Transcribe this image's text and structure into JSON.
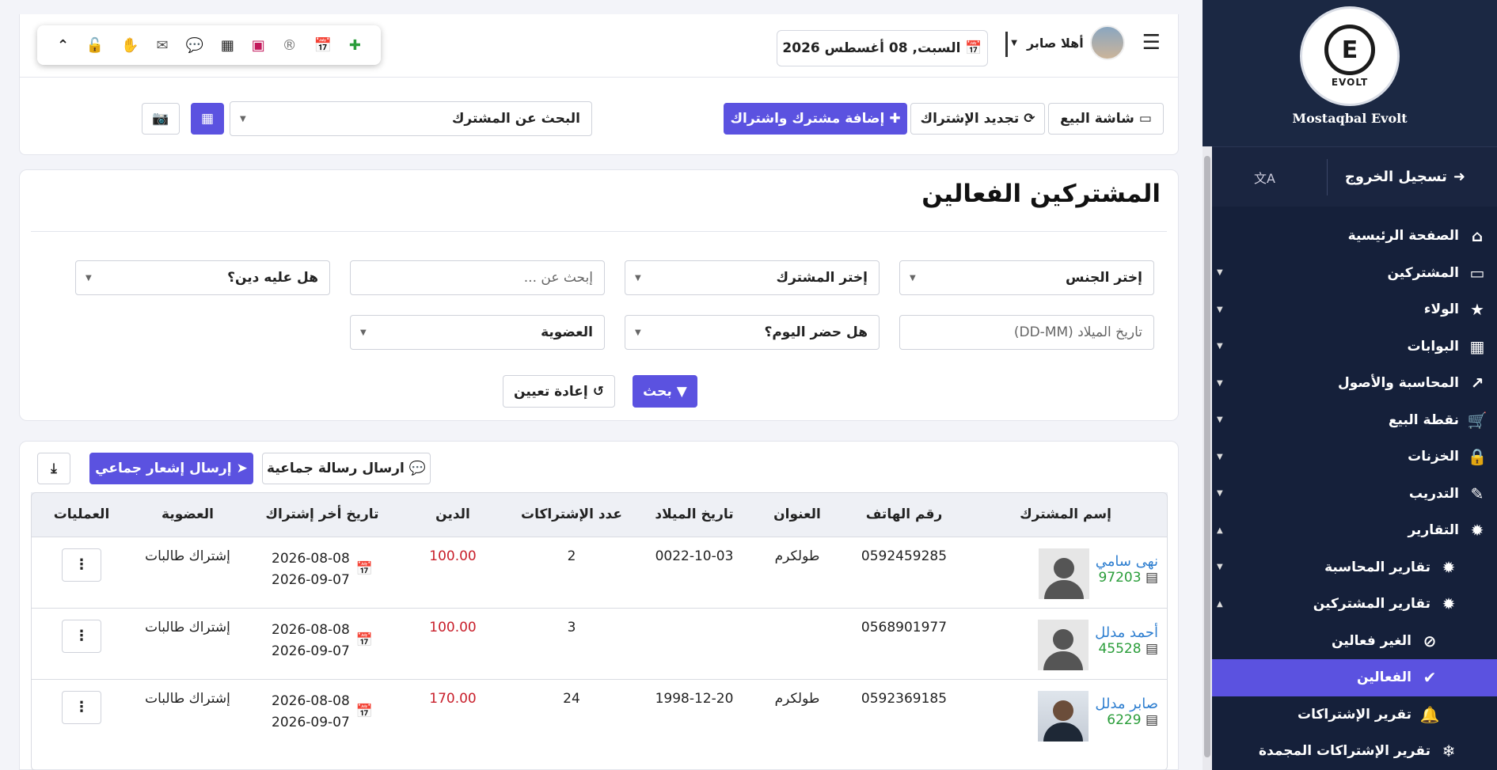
{
  "sidebar": {
    "brand_name": "Mostaqbal Evolt",
    "logo_text": "EVOLT",
    "logout_label": "تسجيل الخروج",
    "items": [
      {
        "label": "الصفحة الرئيسية",
        "icon": "home-icon"
      },
      {
        "label": "المشتركين",
        "icon": "laptop-icon"
      },
      {
        "label": "الولاء",
        "icon": "star-icon"
      },
      {
        "label": "البوابات",
        "icon": "building-icon"
      },
      {
        "label": "المحاسبة والأصول",
        "icon": "chart-line-icon"
      },
      {
        "label": "نقطة البيع",
        "icon": "cart-icon"
      },
      {
        "label": "الخزنات",
        "icon": "lock-icon"
      },
      {
        "label": "التدريب",
        "icon": "magic-icon"
      },
      {
        "label": "التقارير",
        "icon": "bug-icon"
      },
      {
        "label": "تقارير المحاسبة",
        "icon": "bug-icon"
      },
      {
        "label": "تقارير المشتركين",
        "icon": "bug-icon"
      },
      {
        "label": "الغير فعالين",
        "icon": "ban-icon"
      },
      {
        "label": "الفعالين",
        "icon": "check-icon"
      },
      {
        "label": "تقرير الإشتراكات",
        "icon": "bell-icon"
      },
      {
        "label": "تقرير الإشتراكات المجمدة",
        "icon": "snowflake-icon"
      }
    ]
  },
  "header": {
    "user_greeting": "أهلا صابر",
    "date": "السبت, 08 أغسطس 2026"
  },
  "actions": {
    "pos_screen": "شاشة البيع",
    "renew": "تجديد الإشتراك",
    "add": "إضافة مشترك واشتراك",
    "search_member": "البحث عن المشترك"
  },
  "filters": {
    "title": "المشتركين الفعالين",
    "gender": "إختر الجنس",
    "member": "إختر المشترك",
    "search_placeholder": "إبحث عن ...",
    "has_debt": "هل عليه دين؟",
    "birthdate_placeholder": "تاريخ الميلاد (DD-MM)",
    "attended_today": "هل حضر اليوم؟",
    "membership": "العضوية",
    "search_btn": "بحث",
    "reset_btn": "إعادة تعيين"
  },
  "table_actions": {
    "group_message": "ارسال رسالة جماعية",
    "group_notification": "إرسال إشعار جماعي"
  },
  "table": {
    "headers": [
      "إسم المشترك",
      "رقم الهاتف",
      "العنوان",
      "تاريخ الميلاد",
      "عدد الإشتراكات",
      "الدين",
      "تاريخ أخر إشتراك",
      "العضوية",
      "العمليات"
    ],
    "rows": [
      {
        "name": "نهى سامي",
        "code": "97203",
        "phone": "0592459285",
        "address": "طولكرم",
        "birth": "0022-10-03",
        "count": "2",
        "debt": "100.00",
        "start": "2026-08-08",
        "end": "2026-09-07",
        "membership": "إشتراك طالبات"
      },
      {
        "name": "أحمد مدلل",
        "code": "45528",
        "phone": "0568901977",
        "address": "",
        "birth": "",
        "count": "3",
        "debt": "100.00",
        "start": "2026-08-08",
        "end": "2026-09-07",
        "membership": "إشتراك طالبات"
      },
      {
        "name": "صابر مدلل",
        "code": "6229",
        "phone": "0592369185",
        "address": "طولكرم",
        "birth": "1998-12-20",
        "count": "24",
        "debt": "170.00",
        "start": "2026-08-08",
        "end": "2026-09-07",
        "membership": "إشتراك طالبات"
      }
    ]
  },
  "colors": {
    "accent": "#5b52e0",
    "sidebar": "#15203a",
    "debt": "#c81e2a",
    "link": "#2f7fd0",
    "code": "#2a9d3a"
  }
}
